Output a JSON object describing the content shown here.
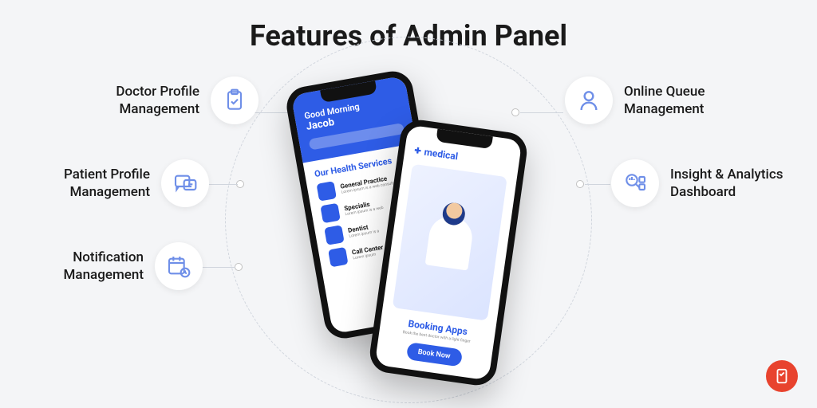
{
  "title": "Features of Admin Panel",
  "features": {
    "left": [
      {
        "label": "Doctor Profile Management"
      },
      {
        "label": "Patient Profile Management"
      },
      {
        "label": "Notification Management"
      }
    ],
    "right": [
      {
        "label": "Online Queue Management"
      },
      {
        "label": "Insight & Analytics Dashboard"
      }
    ]
  },
  "phone1": {
    "greeting": "Good Morning",
    "user": "Jacob",
    "section": "Our Health Services",
    "services": [
      {
        "name": "General Practice",
        "sub": "Lorem ipsum is a web consultant"
      },
      {
        "name": "Specialis",
        "sub": "Lorem ipsum is a web"
      },
      {
        "name": "Dentist",
        "sub": "Lorem ipsum is a"
      },
      {
        "name": "Call Center",
        "sub": "Lorem ipsum"
      }
    ]
  },
  "phone2": {
    "brand": "medical",
    "app_title": "Booking Apps",
    "app_sub": "Book the best doctor with a light finger",
    "cta": "Book Now"
  }
}
